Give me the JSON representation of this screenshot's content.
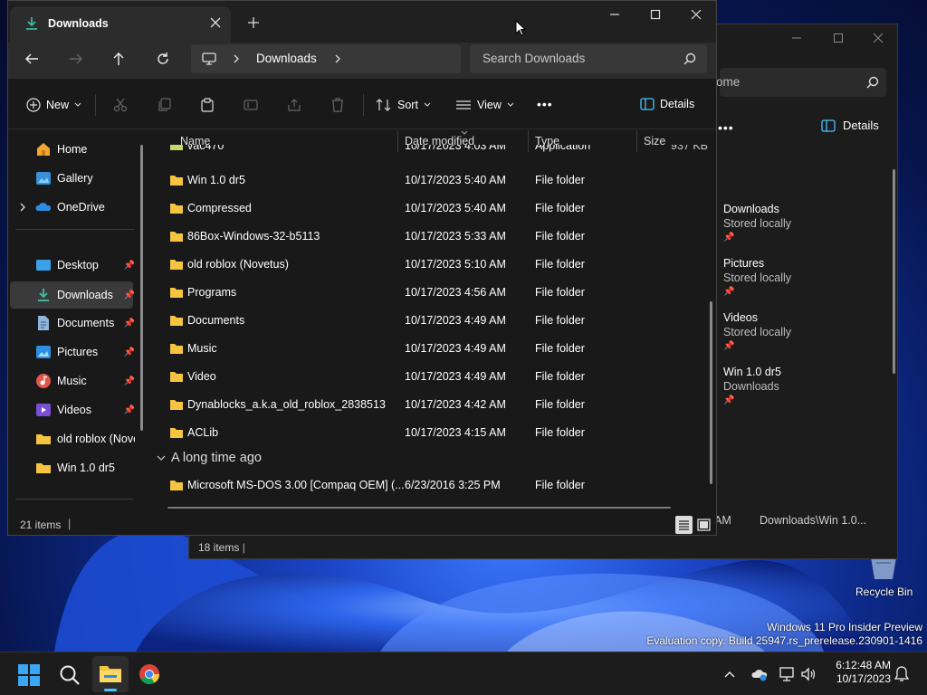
{
  "desktop": {
    "recycle_bin_label": "Recycle Bin",
    "watermark_line1": "Windows 11 Pro Insider Preview",
    "watermark_line2": "Evaluation copy. Build 25947.rs_prerelease.230901-1416"
  },
  "back_window": {
    "search_text": "ome",
    "details_label": "Details",
    "quick_access": [
      {
        "title": "Downloads",
        "sub": "Stored locally"
      },
      {
        "title": "Pictures",
        "sub": "Stored locally"
      },
      {
        "title": "Videos",
        "sub": "Stored locally"
      },
      {
        "title": "Win 1.0 dr5",
        "sub": "Downloads"
      }
    ],
    "status_items": "18 items",
    "status_time_fragment": "AM",
    "status_path": "Downloads\\Win 1.0..."
  },
  "main_window": {
    "tab_title": "Downloads",
    "breadcrumb": [
      "Downloads"
    ],
    "search_placeholder": "Search Downloads",
    "toolbar": {
      "new_label": "New",
      "sort_label": "Sort",
      "view_label": "View",
      "details_label": "Details"
    },
    "sidebar": [
      {
        "label": "Home",
        "icon": "home-icon"
      },
      {
        "label": "Gallery",
        "icon": "gallery-icon"
      },
      {
        "label": "OneDrive",
        "icon": "onedrive-icon"
      },
      {
        "label": "Desktop",
        "icon": "desktop-icon",
        "pinned": true
      },
      {
        "label": "Downloads",
        "icon": "downloads-icon",
        "pinned": true,
        "selected": true
      },
      {
        "label": "Documents",
        "icon": "documents-icon",
        "pinned": true
      },
      {
        "label": "Pictures",
        "icon": "pictures-icon",
        "pinned": true
      },
      {
        "label": "Music",
        "icon": "music-icon",
        "pinned": true
      },
      {
        "label": "Videos",
        "icon": "videos-icon",
        "pinned": true
      },
      {
        "label": "old roblox (Novetus)",
        "icon": "folder-icon"
      },
      {
        "label": "Win 1.0 dr5",
        "icon": "folder-icon"
      }
    ],
    "columns": [
      "Name",
      "Date modified",
      "Type",
      "Size"
    ],
    "partial_row": {
      "name": "vac470",
      "date": "10/17/2023 4:03 AM",
      "type": "Application",
      "size": "937 KB"
    },
    "files": [
      {
        "name": "Win 1.0 dr5",
        "date": "10/17/2023 5:40 AM",
        "type": "File folder"
      },
      {
        "name": "Compressed",
        "date": "10/17/2023 5:40 AM",
        "type": "File folder"
      },
      {
        "name": "86Box-Windows-32-b5113",
        "date": "10/17/2023 5:33 AM",
        "type": "File folder"
      },
      {
        "name": "old roblox (Novetus)",
        "date": "10/17/2023 5:10 AM",
        "type": "File folder"
      },
      {
        "name": "Programs",
        "date": "10/17/2023 4:56 AM",
        "type": "File folder"
      },
      {
        "name": "Documents",
        "date": "10/17/2023 4:49 AM",
        "type": "File folder"
      },
      {
        "name": "Music",
        "date": "10/17/2023 4:49 AM",
        "type": "File folder"
      },
      {
        "name": "Video",
        "date": "10/17/2023 4:49 AM",
        "type": "File folder"
      },
      {
        "name": "Dynablocks_a.k.a_old_roblox_2838513",
        "date": "10/17/2023 4:42 AM",
        "type": "File folder"
      },
      {
        "name": "ACLib",
        "date": "10/17/2023 4:15 AM",
        "type": "File folder"
      }
    ],
    "group_label": "A long time ago",
    "old_files": [
      {
        "name": "Microsoft MS-DOS 3.00 [Compaq OEM] (...",
        "date": "6/23/2016 3:25 PM",
        "type": "File folder"
      }
    ],
    "status_items": "21 items"
  },
  "taskbar": {
    "time": "6:12:48 AM",
    "date": "10/17/2023"
  },
  "colors": {
    "folder": "#f5c542",
    "accent": "#4cc2ff",
    "window_bg": "#191919"
  }
}
